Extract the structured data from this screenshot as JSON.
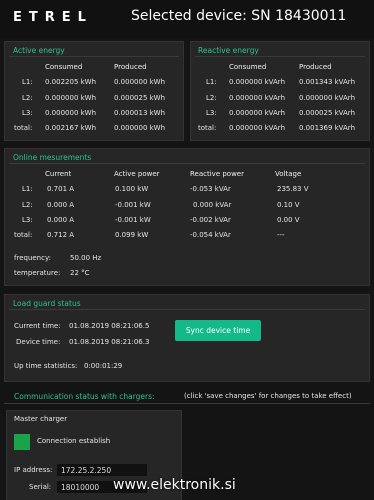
{
  "header": {
    "logo": "ETREL",
    "device_title": "Selected device:  SN 18430011"
  },
  "active_energy": {
    "title": "Active energy",
    "col_consumed": "Consumed",
    "col_produced": "Produced",
    "rows": [
      {
        "label": "L1:",
        "consumed": "0.002205 kWh",
        "produced": "0.000000 kWh"
      },
      {
        "label": "L2:",
        "consumed": "0.000000 kWh",
        "produced": "0.000025 kWh"
      },
      {
        "label": "L3:",
        "consumed": "0.000000 kWh",
        "produced": "0.000013 kWh"
      },
      {
        "label": "total:",
        "consumed": "0.002167 kWh",
        "produced": "0.000000 kWh"
      }
    ]
  },
  "reactive_energy": {
    "title": "Reactive energy",
    "col_consumed": "Consumed",
    "col_produced": "Produced",
    "rows": [
      {
        "label": "L1:",
        "consumed": "0.000000 kVArh",
        "produced": "0.001343 kVArh"
      },
      {
        "label": "L2:",
        "consumed": "0.000000 kVArh",
        "produced": "0.000000 kVArh"
      },
      {
        "label": "L3:",
        "consumed": "0.000000 kVArh",
        "produced": "0.000025 kVArh"
      },
      {
        "label": "total:",
        "consumed": "0.000000 kVArh",
        "produced": "0.001369 kVArh"
      }
    ]
  },
  "online_measurements": {
    "title": "Online mesurements",
    "col_current": "Current",
    "col_active_power": "Active power",
    "col_reactive_power": "Reactive power",
    "col_voltage": "Voltage",
    "rows": [
      {
        "label": "L1:",
        "current": "0.701 A",
        "active": "0.100 kW",
        "reactive": "-0.053 kVAr",
        "voltage": "235.83 V"
      },
      {
        "label": "L2:",
        "current": "0.000 A",
        "active": "-0.001 kW",
        "reactive": "0.000 kVAr",
        "voltage": "0.10 V"
      },
      {
        "label": "L3:",
        "current": "0.000 A",
        "active": "-0.001 kW",
        "reactive": "-0.002 kVAr",
        "voltage": "0.00 V"
      },
      {
        "label": "total:",
        "current": "0.712 A",
        "active": "0.099 kW",
        "reactive": "-0.054 kVAr",
        "voltage": "---"
      }
    ],
    "frequency_label": "frequency:",
    "frequency_value": "50.00 Hz",
    "temperature_label": "temperature:",
    "temperature_value": "22 °C"
  },
  "load_guard": {
    "title": "Load guard status",
    "current_time_label": "Current time:",
    "current_time_value": "01.08.2019 08:21:06.5",
    "device_time_label": "Device time:",
    "device_time_value": "01.08.2019 08:21:06.3",
    "sync_button": "Sync device time",
    "uptime_label": "Up time statistics:",
    "uptime_value": "0:00:01:29"
  },
  "communication": {
    "title": "Communication status with chargers:",
    "note": "(click 'save changes' for changes to take effect)"
  },
  "master_charger": {
    "title": "Master charger",
    "status_text": "Connection establish",
    "ip_label": "IP address:",
    "ip_value": "172.25.2.250",
    "serial_label": "Serial:",
    "serial_value": "18010000"
  },
  "watermark": "www.elektronik.si",
  "colors": {
    "accent": "#2ec18f",
    "button": "#14b98a",
    "status_ok": "#1aa34a"
  }
}
